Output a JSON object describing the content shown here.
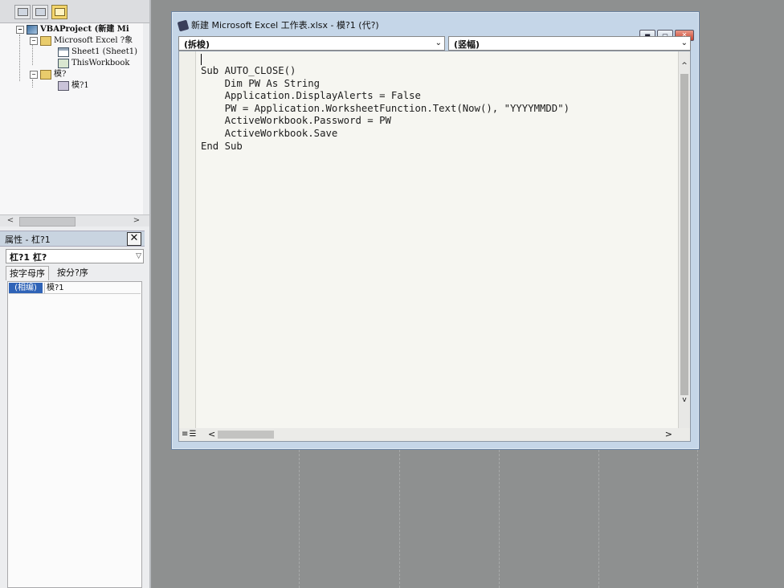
{
  "left_panel": {
    "tree": {
      "project": "VBAProject (新建 Mi",
      "excel_objects": "Microsoft Excel ?象",
      "sheet1": "Sheet1 (Sheet1)",
      "thisworkbook": "ThisWorkbook",
      "modules_folder": "模?",
      "module1": "模?1"
    },
    "properties": {
      "title": "属性 - 杠?1",
      "close": "✕",
      "combo_value": "杠?1 杠?",
      "tabs": [
        "按字母序",
        "按分?序"
      ],
      "row_key": "(相编)",
      "row_value": "模?1"
    }
  },
  "code_window": {
    "title": "新建 Microsoft Excel 工作表.xlsx - 模?1 (代?)",
    "object_combo": "(拆梭)",
    "proc_combo": "(竖幅)",
    "window_buttons": {
      "minimize": "▬",
      "maximize": "▭",
      "close": "✕"
    },
    "code_lines": [
      "Sub AUTO_CLOSE()",
      "    Dim PW As String",
      "    Application.DisplayAlerts = False",
      "    PW = Application.WorksheetFunction.Text(Now(), \"YYYYMMDD\")",
      "    ActiveWorkbook.Password = PW",
      "    ActiveWorkbook.Save",
      "End Sub"
    ]
  },
  "colors": {
    "selection": "#2f63b7",
    "code_bg": "#f6f6f1",
    "window_frame": "#c5d6e8"
  }
}
